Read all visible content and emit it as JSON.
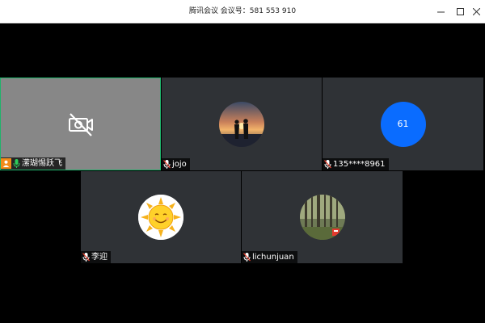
{
  "window": {
    "title": "腾讯会议 会议号：581 553 910",
    "controls": [
      "minimize-icon",
      "maximize-icon",
      "close-icon"
    ]
  },
  "participants": [
    {
      "name": "潆瑚惕跃飞",
      "is_self": true,
      "camera": "off",
      "mic": "speaking",
      "host_badge": "person-icon",
      "active_border": "#1fb36b"
    },
    {
      "name": "jojo",
      "avatar": "couple-sunset-photo",
      "mic": "muted"
    },
    {
      "name": "135****8961",
      "avatar_initial": "61",
      "avatar_color": "#0a6cff",
      "mic": "muted"
    },
    {
      "name": "李迎",
      "avatar": "sun-smiley-icon",
      "mic": "muted"
    },
    {
      "name": "lichunjuan",
      "avatar": "forest-photo",
      "mic": "muted"
    }
  ]
}
